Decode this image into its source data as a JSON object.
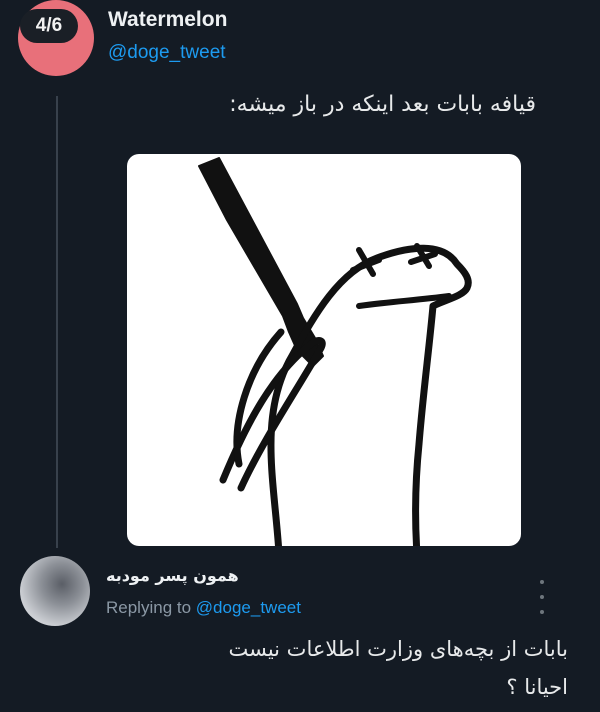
{
  "thread": {
    "counter": "4/6"
  },
  "tweet": {
    "author_name": "Watermelon",
    "author_handle": "@doge_tweet",
    "text": "قیافه بابات بعد اینکه در باز میشه:",
    "media_description": "meme-drawing-figure-with-bat"
  },
  "reply": {
    "author_name": "همون پسر مودبه",
    "replying_prefix": "Replying to",
    "replying_mention": "@doge_tweet",
    "text_line1": "بابات از بچه‌های وزارت اطلاعات نیست",
    "text_line2": "احیانا ؟",
    "more_icon": "more-vertical-icon"
  },
  "colors": {
    "background": "#141b24",
    "accent_blue": "#1d9bf0",
    "avatar_pink": "#e8707a",
    "muted_text": "#8b98a5"
  }
}
